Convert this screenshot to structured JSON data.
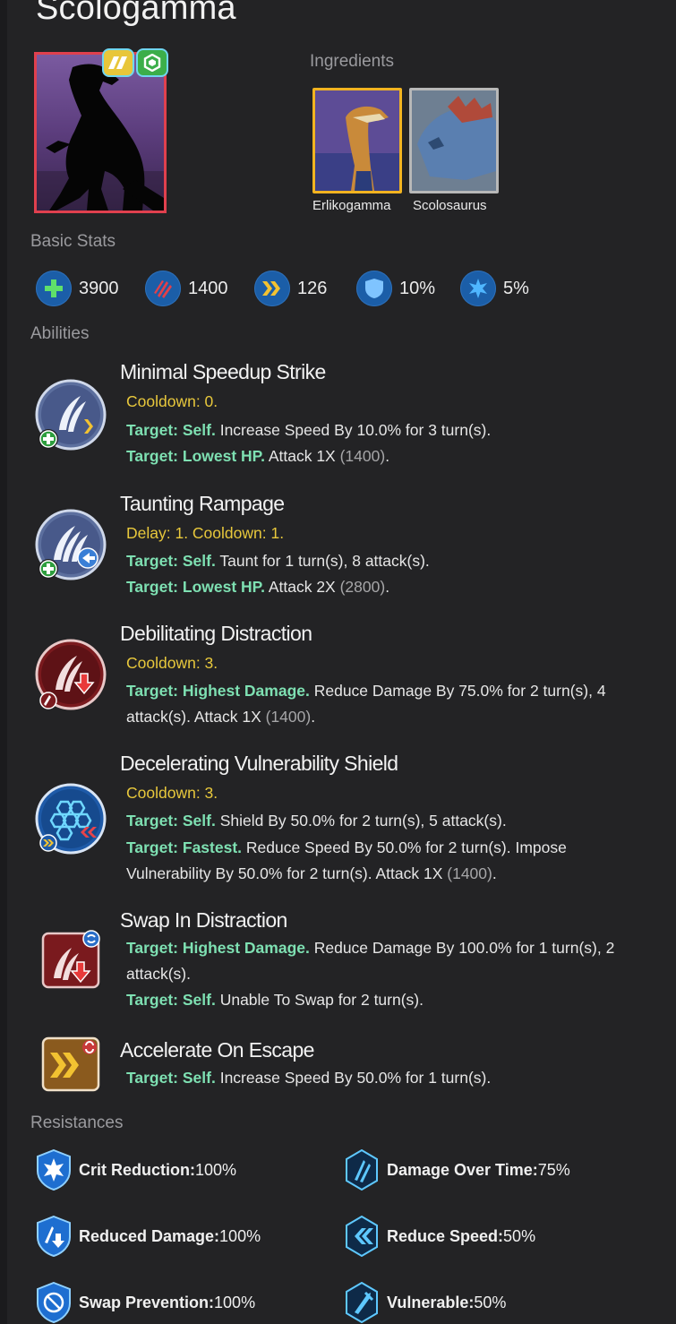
{
  "creature": {
    "name": "Scologamma",
    "rarity_icon": "rarity-badge-icon",
    "class_icon": "class-badge-icon"
  },
  "ingredients": {
    "label": "Ingredients",
    "items": [
      {
        "name": "Erlikogamma"
      },
      {
        "name": "Scolosaurus"
      }
    ]
  },
  "basic_stats": {
    "label": "Basic Stats",
    "items": [
      {
        "icon": "health-icon",
        "value": "3900"
      },
      {
        "icon": "damage-icon",
        "value": "1400"
      },
      {
        "icon": "speed-icon",
        "value": "126"
      },
      {
        "icon": "armor-icon",
        "value": "10%"
      },
      {
        "icon": "crit-icon",
        "value": "5%"
      }
    ]
  },
  "abilities": {
    "label": "Abilities",
    "items": [
      {
        "name": "Minimal Speedup Strike",
        "timing": "Cooldown: 0.",
        "lines": [
          {
            "target": "Target: Self.",
            "text": " Increase Speed By 10.0% for 3 turn(s)."
          },
          {
            "target": "Target: Lowest HP.",
            "text": " Attack 1X ",
            "muted": "(1400)",
            "tail": "."
          }
        ]
      },
      {
        "name": "Taunting Rampage",
        "timing": "Delay: 1. Cooldown: 1.",
        "lines": [
          {
            "target": "Target: Self.",
            "text": " Taunt for 1 turn(s), 8 attack(s)."
          },
          {
            "target": "Target: Lowest HP.",
            "text": " Attack 2X ",
            "muted": "(2800)",
            "tail": "."
          }
        ]
      },
      {
        "name": "Debilitating Distraction",
        "timing": "Cooldown: 3.",
        "lines": [
          {
            "target": "Target: Highest Damage.",
            "text": " Reduce Damage By 75.0% for 2 turn(s), 4"
          },
          {
            "target": "",
            "text": "attack(s).  Attack 1X ",
            "muted": "(1400)",
            "tail": "."
          }
        ]
      },
      {
        "name": "Decelerating Vulnerability Shield",
        "timing": "Cooldown: 3.",
        "lines": [
          {
            "target": "Target: Self.",
            "text": " Shield By 50.0% for 2 turn(s), 5 attack(s)."
          },
          {
            "target": "Target: Fastest.",
            "text": " Reduce Speed By 50.0% for 2 turn(s).  Impose"
          },
          {
            "target": "",
            "text": "Vulnerability By 50.0% for 2 turn(s).  Attack 1X ",
            "muted": "(1400)",
            "tail": "."
          }
        ]
      },
      {
        "name": "Swap In Distraction",
        "timing": "",
        "lines": [
          {
            "target": "Target: Highest Damage.",
            "text": " Reduce Damage By 100.0% for 1 turn(s), 2"
          },
          {
            "target": "",
            "text": "attack(s)."
          },
          {
            "target": "Target: Self.",
            "text": " Unable To Swap for 2 turn(s)."
          }
        ]
      },
      {
        "name": "Accelerate On Escape",
        "timing": "",
        "lines": [
          {
            "target": "Target: Self.",
            "text": " Increase Speed By 50.0% for 1 turn(s)."
          }
        ]
      }
    ]
  },
  "resistances": {
    "label": "Resistances",
    "items": [
      {
        "icon": "crit-reduction-icon",
        "name": "Crit Reduction:",
        "value": " 100%"
      },
      {
        "icon": "damage-over-time-icon",
        "name": "Damage Over Time:",
        "value": " 75%"
      },
      {
        "icon": "reduced-damage-icon",
        "name": "Reduced Damage:",
        "value": " 100%"
      },
      {
        "icon": "reduce-speed-icon",
        "name": "Reduce Speed:",
        "value": " 50%"
      },
      {
        "icon": "swap-prevention-icon",
        "name": "Swap Prevention:",
        "value": " 100%"
      },
      {
        "icon": "vulnerable-icon",
        "name": "Vulnerable:",
        "value": " 50%"
      }
    ]
  }
}
